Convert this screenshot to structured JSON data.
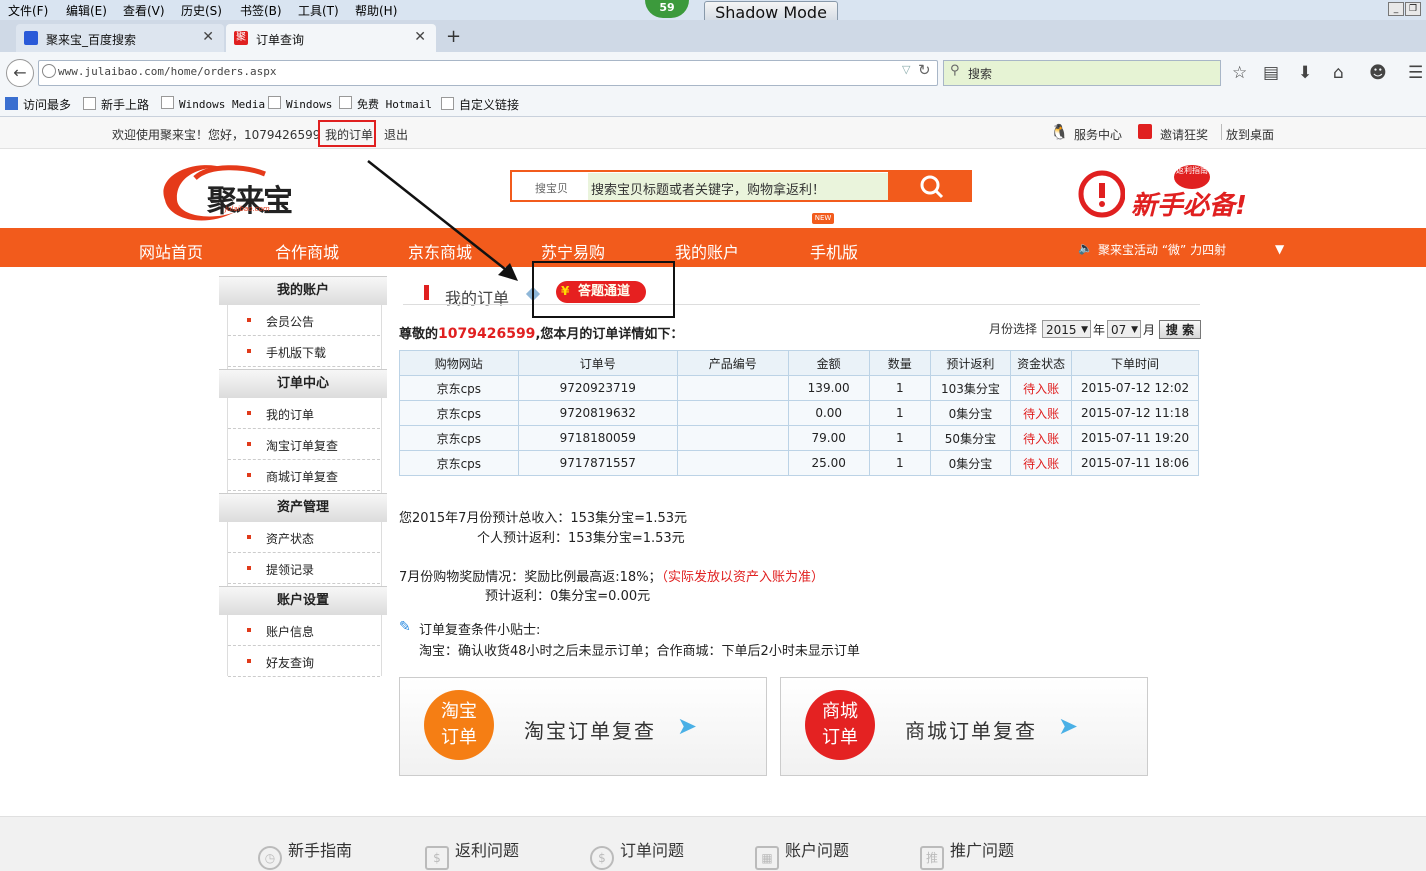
{
  "browser": {
    "menu": [
      "文件(F)",
      "编辑(E)",
      "查看(V)",
      "历史(S)",
      "书签(B)",
      "工具(T)",
      "帮助(H)"
    ],
    "badge": "59",
    "shadow_mode": "Shadow Mode",
    "tabs": [
      {
        "label": "聚来宝_百度搜索",
        "active": false
      },
      {
        "label": "订单查询",
        "active": true
      }
    ],
    "new_tab": "+",
    "url": "www.julaibao.com/home/orders.aspx",
    "search_placeholder": "搜索",
    "bookmarks": [
      "访问最多",
      "新手上路",
      "Windows Media",
      "Windows",
      "免费 Hotmail",
      "自定义链接"
    ]
  },
  "site": {
    "top": {
      "welcome": "欢迎使用聚来宝！您好，1079426599",
      "my_orders": "我的订单",
      "logout": "退出",
      "service": "服务中心",
      "invite": "邀请狂奖",
      "desktop": "放到桌面"
    },
    "logo_text": "聚来宝",
    "logo_sub": "julaibao.com",
    "search": {
      "label": "搜宝贝",
      "placeholder": "搜索宝贝标题或者关键字，购物拿返利！"
    },
    "newbie": {
      "text": "新手必备!",
      "tag": "返利指南"
    },
    "nav": [
      "网站首页",
      "合作商城",
      "京东商城",
      "苏宁易购",
      "我的账户",
      "手机版"
    ],
    "new_tag": "NEW",
    "announce": "聚来宝活动 “微” 力四射",
    "sidebar": [
      {
        "head": "我的账户",
        "items": [
          "会员公告",
          "手机版下载"
        ]
      },
      {
        "head": "订单中心",
        "items": [
          "我的订单",
          "淘宝订单复查",
          "商城订单复查"
        ]
      },
      {
        "head": "资产管理",
        "items": [
          "资产状态",
          "提领记录"
        ]
      },
      {
        "head": "账户设置",
        "items": [
          "账户信息",
          "好友查询"
        ]
      }
    ],
    "section_title": "我的订单",
    "answer_channel": "答题通道",
    "greeting_pre": "尊敬的",
    "greeting_uid": "1079426599",
    "greeting_post": ",您本月的订单详情如下：",
    "month_label": "月份选择",
    "year_value": "2015",
    "year_unit": "年",
    "month_value": "07",
    "month_unit": "月",
    "search_btn": "搜 索",
    "table": {
      "headers": [
        "购物网站",
        "订单号",
        "产品编号",
        "金额",
        "数量",
        "预计返利",
        "资金状态",
        "下单时间"
      ],
      "rows": [
        [
          "京东cps",
          "9720923719",
          "",
          "139.00",
          "1",
          "103集分宝",
          "待入账",
          "2015-07-12 12:02"
        ],
        [
          "京东cps",
          "9720819632",
          "",
          "0.00",
          "1",
          "0集分宝",
          "待入账",
          "2015-07-12 11:18"
        ],
        [
          "京东cps",
          "9718180059",
          "",
          "79.00",
          "1",
          "50集分宝",
          "待入账",
          "2015-07-11 19:20"
        ],
        [
          "京东cps",
          "9717871557",
          "",
          "25.00",
          "1",
          "0集分宝",
          "待入账",
          "2015-07-11 18:06"
        ]
      ]
    },
    "summary": {
      "total": "您2015年7月份预计总收入：153集分宝=1.53元",
      "personal": "个人预计返利：153集分宝=1.53元",
      "reward": "7月份购物奖励情况：奖励比例最高返:18%；",
      "reward_note": "（实际发放以资产入账为准）",
      "reward_est": "预计返利：0集分宝=0.00元",
      "tips_title": "订单复查条件小贴士:",
      "tips_body": "淘宝：确认收货48小时之后未显示订单；合作商城：下单后2小时未显示订单"
    },
    "cards": [
      {
        "circle": "淘宝订单",
        "circle_line1": "淘宝",
        "circle_line2": "订单",
        "label": "淘宝订单复查",
        "color": "#f57e14"
      },
      {
        "circle": "商城订单",
        "circle_line1": "商城",
        "circle_line2": "订单",
        "label": "商城订单复查",
        "color": "#e42222"
      }
    ],
    "footer": [
      "新手指南",
      "返利问题",
      "订单问题",
      "账户问题",
      "推广问题"
    ]
  }
}
